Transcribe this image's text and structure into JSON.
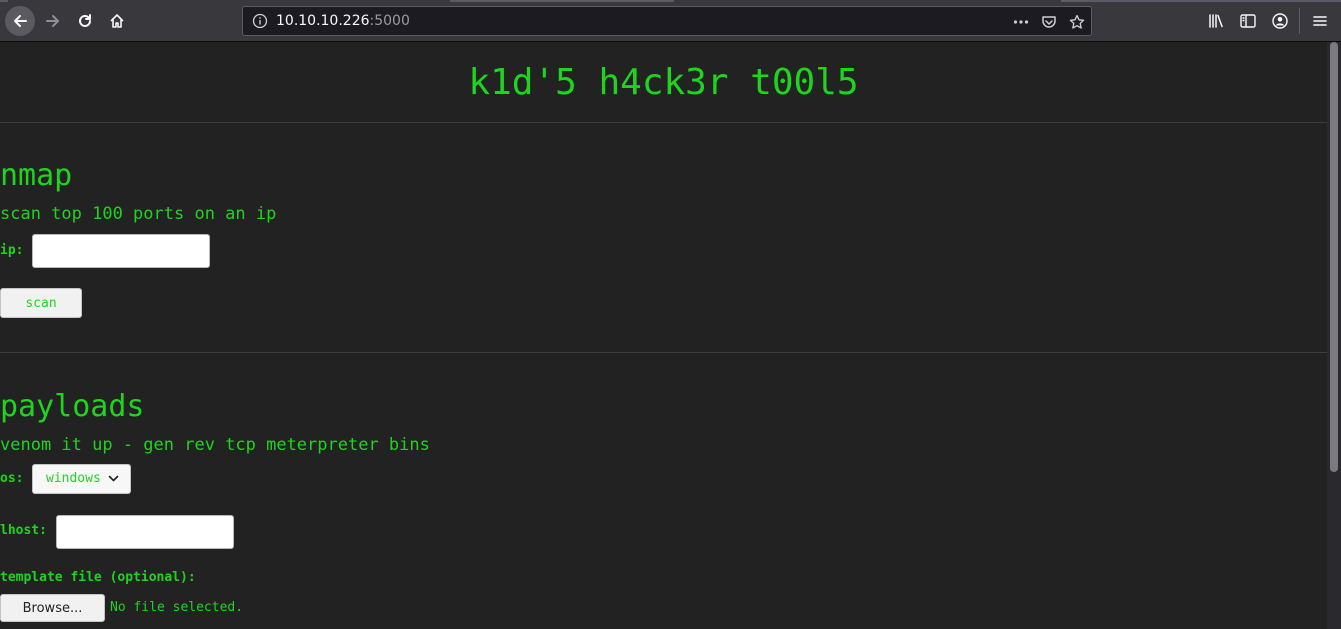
{
  "browser": {
    "url_host": "10.10.10.226",
    "url_port": ":5000"
  },
  "page": {
    "title": "k1d'5 h4ck3r t00l5",
    "nmap": {
      "heading": "nmap",
      "description": "scan top 100 ports on an ip",
      "ip_label": "ip:",
      "ip_value": "",
      "scan_button": "scan"
    },
    "payloads": {
      "heading": "payloads",
      "description": "venom it up - gen rev tcp meterpreter bins",
      "os_label": "os:",
      "os_selected": "windows",
      "lhost_label": "lhost:",
      "lhost_value": "",
      "template_label": "template file (optional):",
      "browse_button": "Browse...",
      "no_file_text": "No file selected."
    }
  },
  "icons": {
    "back": "back-arrow-icon",
    "forward": "forward-arrow-icon",
    "reload": "reload-icon",
    "home": "home-icon",
    "site_info": "info-icon",
    "page_actions": "more-dots-icon",
    "pocket": "pocket-icon",
    "bookmark": "star-icon",
    "library": "library-icon",
    "sidebar": "sidebar-icon",
    "account": "account-icon",
    "menu": "hamburger-menu-icon"
  }
}
